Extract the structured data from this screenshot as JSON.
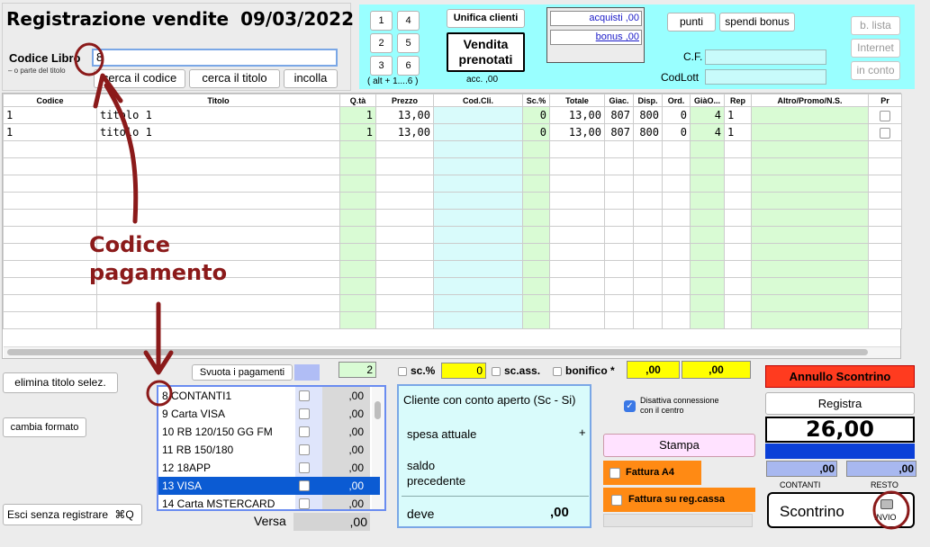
{
  "header": {
    "title": "Registrazione vendite",
    "date": "09/03/2022",
    "codice_label": "Codice Libro",
    "codice_hint": "– o parte del  titolo",
    "codice_value": "8",
    "btn_cerca_codice": "cerca il codice",
    "btn_cerca_titolo": "cerca il titolo",
    "btn_incolla": "incolla"
  },
  "keypad": {
    "keys": [
      "1",
      "4",
      "2",
      "5",
      "3",
      "6"
    ],
    "hint": "( alt + 1....6 )"
  },
  "panel": {
    "unifica": "Unifica clienti",
    "vendita_line1": "Vendita",
    "vendita_line2": "prenotati",
    "acc": "acc. ,00",
    "acquisti": "acquisti ,00",
    "bonus": "bonus ,00",
    "punti": "punti",
    "spendi": "spendi bonus",
    "cf_label": "C.F.",
    "codlott_label": "CodLott",
    "b_lista": "b. lista",
    "internet": "Internet",
    "in_conto": "in conto"
  },
  "table": {
    "columns": [
      "Codice",
      "Titolo",
      "Q.tà",
      "Prezzo",
      "Cod.Cli.",
      "Sc.%",
      "Totale",
      "Giac.",
      "Disp.",
      "Ord.",
      "GiàO...",
      "Rep",
      "Altro/Promo/N.S.",
      "Pr"
    ],
    "rows": [
      {
        "codice": "1",
        "titolo": "titolo 1",
        "qta": "1",
        "prezzo": "13,00",
        "codcli": "",
        "sc": "0",
        "totale": "13,00",
        "giac": "807",
        "disp": "800",
        "ord": "0",
        "giao": "4",
        "rep": "1",
        "altro": ""
      },
      {
        "codice": "1",
        "titolo": "titolo 1",
        "qta": "1",
        "prezzo": "13,00",
        "codcli": "",
        "sc": "0",
        "totale": "13,00",
        "giac": "807",
        "disp": "800",
        "ord": "0",
        "giao": "4",
        "rep": "1",
        "altro": ""
      }
    ]
  },
  "left_buttons": {
    "elimina": "elimina titolo selez.",
    "cambia": "cambia formato",
    "esci": "Esci senza registrare"
  },
  "payments": {
    "svuota": "Svuota i pagamenti",
    "items": [
      {
        "label": "8 CONTANTI1",
        "amount": ",00",
        "selected": false
      },
      {
        "label": "9 Carta VISA",
        "amount": ",00",
        "selected": false
      },
      {
        "label": "10 RB 120/150 GG FM",
        "amount": ",00",
        "selected": false
      },
      {
        "label": "11 RB 150/180",
        "amount": ",00",
        "selected": false
      },
      {
        "label": "12 18APP",
        "amount": ",00",
        "selected": false
      },
      {
        "label": "13 VISA",
        "amount": ",00",
        "selected": true
      },
      {
        "label": "14 Carta MSTERCARD",
        "amount": ",00",
        "selected": false
      }
    ],
    "versa_label": "Versa",
    "versa_value": ",00"
  },
  "middle": {
    "qty": "2",
    "sc_label": "sc.%",
    "sc_value": "0",
    "scass_label": "sc.ass.",
    "bonifico_label": "bonifico *",
    "bonifico_val1": ",00",
    "bonifico_val2": ",00",
    "cliente_title": "Cliente con conto aperto (Sc - Si)",
    "spesa_label": "spesa attuale",
    "plus": "+",
    "saldo_line1": "saldo",
    "saldo_line2": "precedente",
    "deve_label": "deve",
    "deve_value": ",00"
  },
  "options": {
    "disattiva_line1": "Disattiva connessione",
    "disattiva_line2": "con il centro",
    "stampa": "Stampa",
    "fattura_a4": "Fattura A4",
    "fattura_reg": "Fattura su reg.cassa"
  },
  "right": {
    "annullo": "Annullo Scontrino",
    "registra": "Registra",
    "total": "26,00",
    "contanti_value": ",00",
    "resto_value": ",00",
    "contanti_label": "CONTANTI",
    "resto_label": "RESTO",
    "scontrino": "Scontrino",
    "invio": "INVIO"
  },
  "annotation": {
    "line1": "Codice",
    "line2": "pagamento"
  },
  "colors": {
    "cyan": "#99ffff",
    "annotation": "#8b1a1a",
    "selection": "#0b5bd3",
    "red": "#ff3b1f",
    "orange": "#ff8a14",
    "yellow": "#ffff00"
  }
}
